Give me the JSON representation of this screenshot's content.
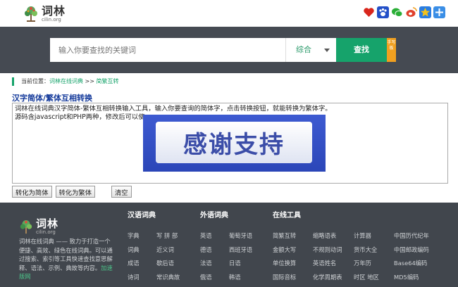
{
  "header": {
    "logo_cn": "词林",
    "logo_en": "cilin.org",
    "share_icons": [
      {
        "name": "favorite-heart-icon",
        "color": "#d9261c"
      },
      {
        "name": "baidu-paw-icon",
        "color": "#2350c8"
      },
      {
        "name": "wechat-icon",
        "color": "#2aae36"
      },
      {
        "name": "weibo-icon",
        "color": "#e0412c"
      },
      {
        "name": "qzone-star-icon",
        "color": "#f4b91a"
      },
      {
        "name": "more-plus-icon",
        "color": "#3a8ee6"
      }
    ]
  },
  "search": {
    "placeholder": "输入你要查找的关键词",
    "select_value": "综合",
    "button": "查找",
    "hand_button": "手写板"
  },
  "breadcrumb": {
    "prefix": "当前位置：",
    "home": "词林在线词典",
    "sep": " >> ",
    "current": "简繁互转"
  },
  "tool": {
    "title": "汉字简体/繁体互相转换",
    "text": "词林在线词典汉字简体-繁体互相转换输入工具，输入你要查询的简体字，点击转换按钮，就能转换为繁体字。\n源码含javascript和PHP两种，修改后可以使",
    "thanks_banner": "感谢支持",
    "buttons": {
      "to_simplified": "转化为简体",
      "to_traditional": "转化为繁体",
      "clear": "清空"
    }
  },
  "footer": {
    "logo_cn": "词林",
    "logo_en": "cilin.org",
    "desc": "词林在线词典 —— 致力于打造一个便捷、高效、绿色在线词典。可以通过搜索、索引等工具快速查找意思解释、语法、示例、典故等内容。",
    "desc_link": "加速版网",
    "columns": [
      {
        "title": "汉语词典",
        "links": [
          "字典",
          "写 拼 部",
          "词典",
          "近义词",
          "成语",
          "歇后语",
          "诗词",
          "常识典故"
        ]
      },
      {
        "title": "外语词典",
        "links": [
          "英语",
          "葡萄牙语",
          "德语",
          "西班牙语",
          "法语",
          "日语",
          "俄语",
          "韩语"
        ]
      },
      {
        "title": "在线工具",
        "links": [
          "简繁互转",
          "缩略语表",
          "计算器",
          "中国历代纪年",
          "金额大写",
          "不规则动词",
          "货币大全",
          "中国邮政编码",
          "单位换算",
          "英语姓名",
          "万年历",
          "Base64编码",
          "国际音标",
          "化学周期表",
          "时区 地区",
          "MD5编码"
        ]
      }
    ]
  }
}
